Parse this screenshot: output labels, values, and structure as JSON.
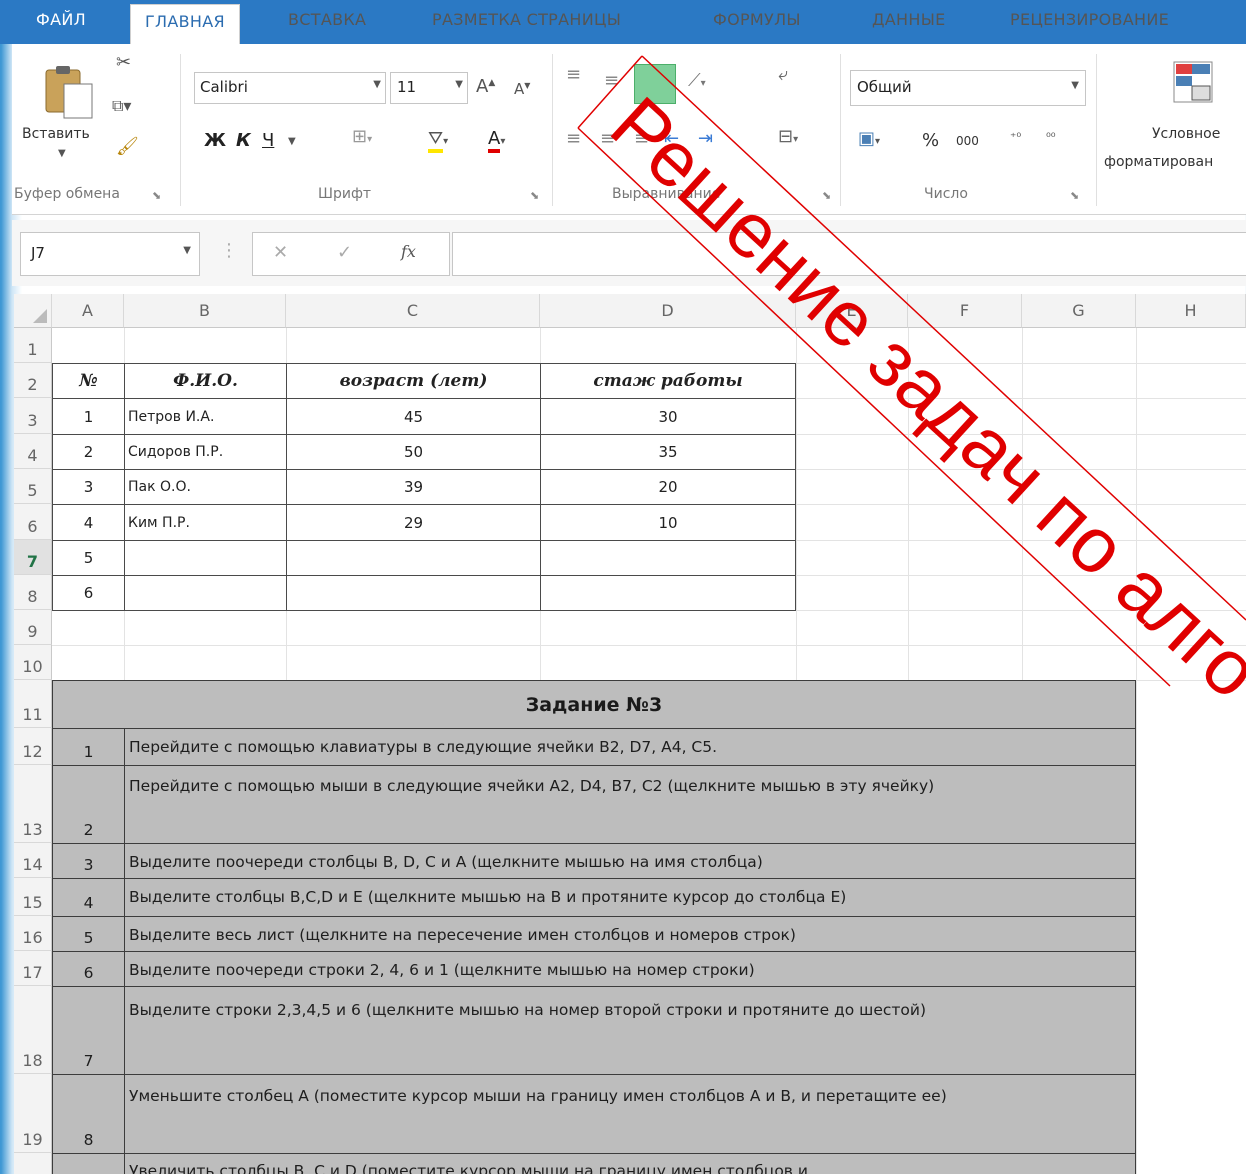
{
  "ribbon": {
    "tabs": [
      "ФАЙЛ",
      "ГЛАВНАЯ",
      "ВСТАВКА",
      "РАЗМЕТКА СТРАНИЦЫ",
      "ФОРМУЛЫ",
      "ДАННЫЕ",
      "РЕЦЕНЗИРОВАНИЕ"
    ],
    "paste_label": "Вставить",
    "clipboard_label": "Буфер обмена",
    "font_name": "Calibri",
    "font_size": "11",
    "font_label": "Шрифт",
    "bold": "Ж",
    "italic": "К",
    "underline": "Ч",
    "alignment_label": "Выравнивание",
    "number_format": "Общий",
    "number_label": "Число",
    "percent": "%",
    "thousands": "000",
    "conditional_label_1": "Условное",
    "conditional_label_2": "форматирован"
  },
  "formula_bar": {
    "name_box": "J7",
    "fx": "fx",
    "formula": ""
  },
  "columns": [
    "A",
    "B",
    "C",
    "D",
    "E",
    "F",
    "G",
    "H"
  ],
  "rows": [
    "1",
    "2",
    "3",
    "4",
    "5",
    "6",
    "7",
    "8",
    "9",
    "10",
    "11",
    "12",
    "13",
    "14",
    "15",
    "16",
    "17",
    "18",
    "19",
    ""
  ],
  "selected_row": "7",
  "table": {
    "headers": [
      "№",
      "Ф.И.О.",
      "возраст (лет)",
      "стаж работы"
    ],
    "rows": [
      [
        "1",
        "Петров И.А.",
        "45",
        "30"
      ],
      [
        "2",
        "Сидоров П.Р.",
        "50",
        "35"
      ],
      [
        "3",
        "Пак О.О.",
        "39",
        "20"
      ],
      [
        "4",
        "Ким П.Р.",
        "29",
        "10"
      ],
      [
        "5",
        "",
        "",
        ""
      ],
      [
        "6",
        "",
        "",
        ""
      ]
    ]
  },
  "assignment": {
    "title": "Задание №3",
    "tasks": [
      {
        "n": "1",
        "text": "Перейдите  с помощью клавиатуры в следующие ячейки В2, D7, А4, С5."
      },
      {
        "n": "2",
        "text": "Перейдите  с помощью мыши в следующие ячейки А2, D4, В7, С2 (щелкните мышью в эту ячейку)"
      },
      {
        "n": "3",
        "text": "Выделите поочереди столбцы В, D, С и А (щелкните мышью на имя столбца)"
      },
      {
        "n": "4",
        "text": "Выделите столбцы В,С,D и Е (щелкните мышью на В и протяните курсор до столбца Е)"
      },
      {
        "n": "5",
        "text": "Выделите весь лист (щелкните на пересечение имен столбцов и номеров строк)"
      },
      {
        "n": "6",
        "text": "Выделите поочереди строки 2, 4, 6 и 1 (щелкните мышью на номер строки)"
      },
      {
        "n": "7",
        "text": "Выделите строки  2,3,4,5 и 6 (щелкните мышью на номер второй строки и протяните до шестой)"
      },
      {
        "n": "8",
        "text": "Уменьшите столбец А (поместите курсор мыши на границу имен столбцов А и В, и перетащите ее)"
      },
      {
        "n": "",
        "text": "Увеличить столбцы В, С и D (поместите курсор мыши на границу имен столбцов и"
      }
    ]
  },
  "watermark": "Решение задач по алго",
  "colors": {
    "ribbon_blue": "#2b79c4",
    "task_fill": "#bdbdbd",
    "watermark": "#e00000",
    "excel_green": "#217346"
  }
}
